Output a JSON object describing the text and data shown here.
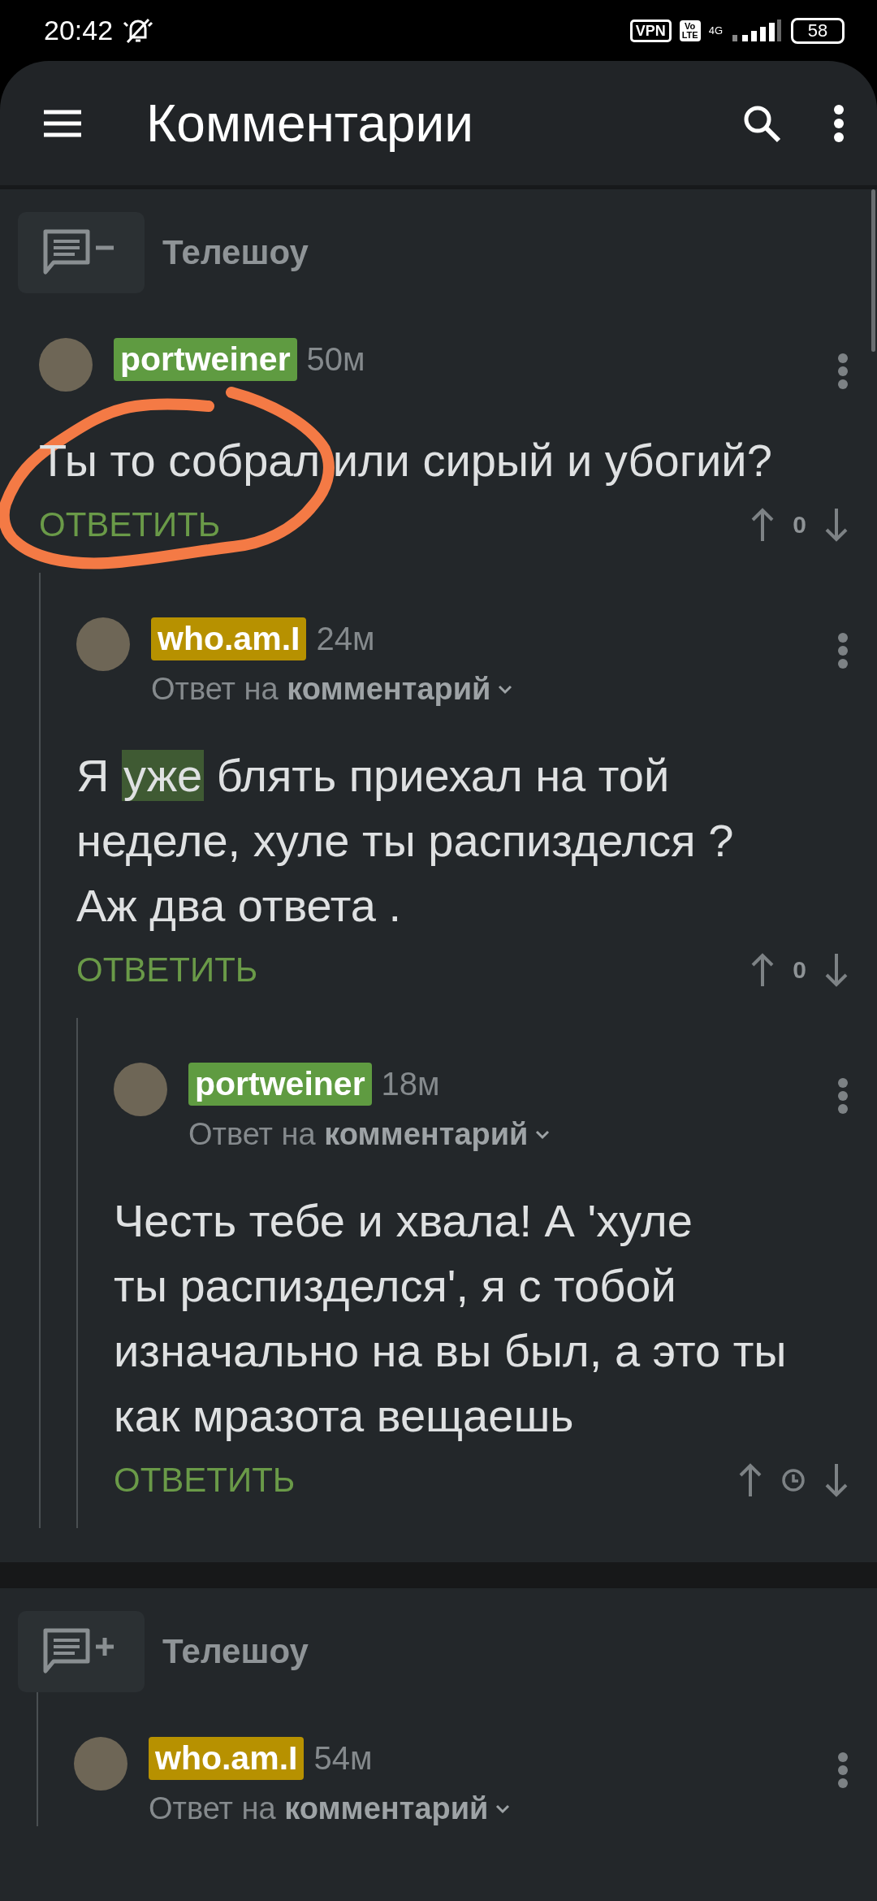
{
  "status_bar": {
    "time": "20:42",
    "vpn": "VPN",
    "volte": [
      "Vo",
      "LTE"
    ],
    "network": "4G",
    "battery": "58"
  },
  "app_bar": {
    "title": "Комментарии"
  },
  "threads": [
    {
      "story": {
        "title": "Телешоу",
        "expanded": true
      },
      "nested": false,
      "comments": [
        {
          "author": "portweiner",
          "color": "#5f9b41",
          "time": "50м",
          "text": [
            {
              "t": "Ты то собрал или сирый и убогий?",
              "highlighted": false
            }
          ],
          "reply": "ОТВЕТИТЬ",
          "score": "0",
          "children": [
            {
              "author": "who.am.I",
              "color": "#b79100",
              "time": "24м",
              "reply_to": {
                "prefix": "Ответ на",
                "link": "комментарий"
              },
              "text": [
                {
                  "t": "Я ",
                  "highlighted": false
                },
                {
                  "t": "уже",
                  "highlighted": true
                },
                {
                  "t": " блять приехал на той\nнеделе, хуле ты распизделся ?\nАж два ответа .",
                  "highlighted": false
                }
              ],
              "reply": "ОТВЕТИТЬ",
              "score": "0",
              "children": [
                {
                  "author": "portweiner",
                  "color": "#5f9b41",
                  "time": "18м",
                  "reply_to": {
                    "prefix": "Ответ на",
                    "link": "комментарий"
                  },
                  "text": [
                    {
                      "t": "Честь тебе и хвала! А 'хуле\nты распизделся', я с тобой\nизначально на вы был, а это ты\nкак мразота вещаешь",
                      "highlighted": false
                    }
                  ],
                  "reply": "ОТВЕТИТЬ"
                }
              ]
            }
          ]
        }
      ]
    },
    {
      "story": {
        "title": "Телешоу",
        "expanded": false
      },
      "nested": true,
      "comments": [
        {
          "author": "who.am.I",
          "color": "#b79100",
          "time": "54м",
          "reply_to": {
            "prefix": "Ответ на",
            "link": "комментарий"
          }
        }
      ]
    }
  ],
  "annotation": {
    "color": "#f47a45"
  }
}
